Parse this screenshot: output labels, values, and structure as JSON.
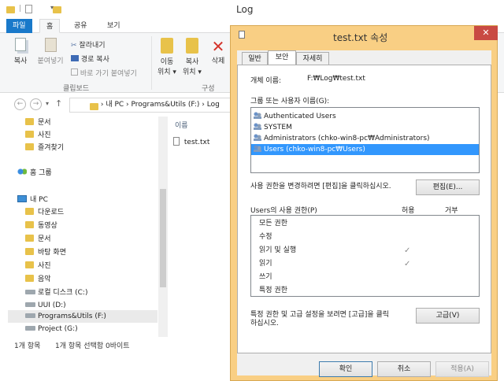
{
  "explorer": {
    "title": "Log",
    "ribbon_tabs": [
      "파일",
      "홈",
      "공유",
      "보기"
    ],
    "clipboard": {
      "copy": "복사",
      "paste": "붙여넣기",
      "cut": "잘라내기",
      "copy_path": "경로 복사",
      "paste_shortcut": "바로 가기 붙여넣기",
      "group": "클립보드"
    },
    "organize": {
      "move": [
        "이동",
        "위치 ▾"
      ],
      "copy_to": [
        "복사",
        "위치 ▾"
      ],
      "delete": "삭제",
      "group": "구성"
    },
    "address": {
      "path": "›  내 PC  ›  Programs&Utils (F:)  ›  Log"
    },
    "nav": {
      "favorites": [
        "문서",
        "사진",
        "즐겨찾기"
      ],
      "homegroup": "홈 그룹",
      "this_pc": "내 PC",
      "pc_items": [
        "다운로드",
        "동영상",
        "문서",
        "바탕 화면",
        "사진",
        "음악"
      ],
      "drives": [
        "로컬 디스크 (C:)",
        "UUI (D:)",
        "Programs&Utils (F:)",
        "Project (G:)"
      ]
    },
    "column_name": "이름",
    "files": [
      "test.txt"
    ],
    "status": {
      "count": "1개 항목",
      "selected": "1개 항목 선택함 0바이트"
    }
  },
  "dialog": {
    "title": "test.txt 속성",
    "tabs": [
      "일반",
      "보안",
      "자세히"
    ],
    "object_name_label": "개체 이름:",
    "object_name_value": "F:₩Log₩test.txt",
    "groups_label": "그룹 또는 사용자 이름(G):",
    "users": [
      "Authenticated Users",
      "SYSTEM",
      "Administrators (chko-win8-pc₩Administrators)",
      "Users (chko-win8-pc₩Users)"
    ],
    "change_perm_text": "사용 권한을 변경하려면 [편집]을 클릭하십시오.",
    "edit_button": "편집(E)...",
    "perm_header": "Users의 사용 권한(P)",
    "allow": "허용",
    "deny": "거부",
    "permissions": [
      {
        "name": "모든 권한",
        "allow": ""
      },
      {
        "name": "수정",
        "allow": ""
      },
      {
        "name": "읽기 및 실행",
        "allow": "✓"
      },
      {
        "name": "읽기",
        "allow": "✓"
      },
      {
        "name": "쓰기",
        "allow": ""
      },
      {
        "name": "특정 권한",
        "allow": ""
      }
    ],
    "advanced_text": [
      "특정 권한 및 고급 설정을 보려면 [고급]을 클릭",
      "하십시오."
    ],
    "advanced_button": "고급(V)",
    "ok": "확인",
    "cancel": "취소",
    "apply": "적용(A)"
  }
}
